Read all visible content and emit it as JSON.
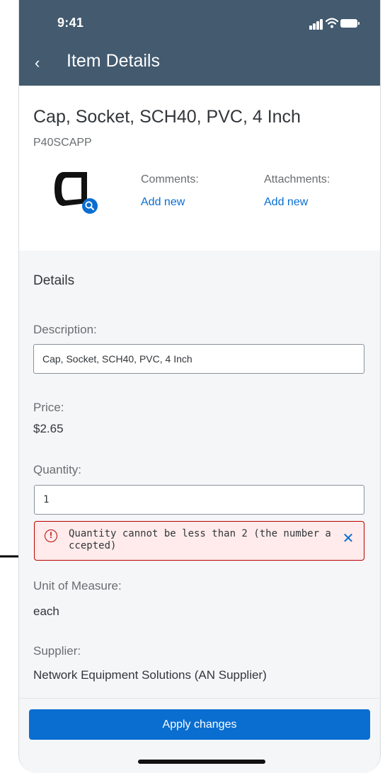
{
  "status_bar": {
    "time": "9:41"
  },
  "header": {
    "back_icon": "chevron-left-icon",
    "back_glyph": "‹",
    "title": "Item Details"
  },
  "item": {
    "title": "Cap, Socket, SCH40, PVC, 4 Inch",
    "code": "P40SCAPP",
    "comments_label": "Comments:",
    "comments_link": "Add new",
    "attachments_label": "Attachments:",
    "attachments_link": "Add new"
  },
  "details": {
    "section_title": "Details",
    "description_label": "Description:",
    "description_value": "Cap, Socket, SCH40, PVC, 4 Inch",
    "price_label": "Price:",
    "price_value": "$2.65",
    "quantity_label": "Quantity:",
    "quantity_value": "1",
    "error_icon_glyph": "!",
    "error_message": "Quantity cannot be less than 2 (the number accepted)",
    "error_close_glyph": "✕",
    "uom_label": "Unit of Measure:",
    "uom_value": "each",
    "supplier_label": "Supplier:",
    "supplier_value": "Network Equipment Solutions (AN Supplier)"
  },
  "footer": {
    "apply_label": "Apply changes"
  },
  "colors": {
    "header_bg": "#435a6f",
    "accent": "#0a6ed1",
    "error": "#bb0000",
    "error_bg": "#ffebeb"
  }
}
